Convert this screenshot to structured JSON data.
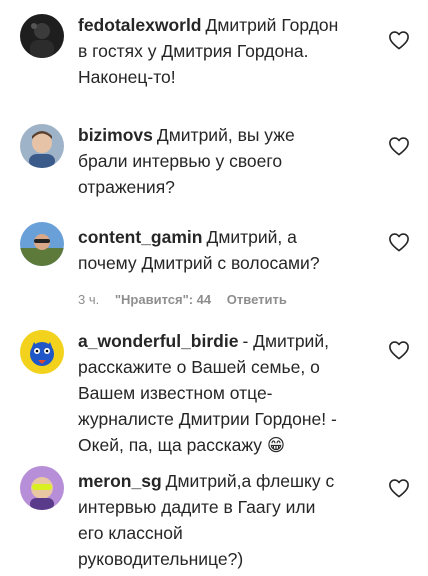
{
  "comments": [
    {
      "username": "fedotalexworld",
      "lines": [
        "Дмитрий Гордон",
        "в гостях у Дмитрия Гордона.",
        "Наконец-то!"
      ],
      "avatar_icon": "user-avatar-dark-photo"
    },
    {
      "username": "bizimovs",
      "lines": [
        "Дмитрий, вы уже",
        "брали интервью у своего",
        "отражения?"
      ],
      "avatar_icon": "user-avatar-boy-photo"
    },
    {
      "username": "content_gamin",
      "lines": [
        "Дмитрий, а",
        "почему Дмитрий с волосами?"
      ],
      "avatar_icon": "user-avatar-landscape-photo",
      "meta": {
        "time": "3 ч.",
        "likes": "\"Нравится\": 44",
        "reply": "Ответить"
      }
    },
    {
      "username": "a_wonderful_birdie",
      "lines": [
        "- Дмитрий,",
        "расскажите о Вашей семье, о",
        "Вашем известном отце-",
        "журналисте Дмитрии Гордоне! -",
        "Окей, па, ща расскажу 😁"
      ],
      "avatar_icon": "user-avatar-bird-cartoon"
    },
    {
      "username": "meron_sg",
      "lines": [
        "Дмитрий,а флешку с",
        "интервью дадите в Гаагу или",
        "его классной",
        "руководительнице?)"
      ],
      "avatar_icon": "user-avatar-sunglasses-photo"
    }
  ],
  "colors": {
    "text": "#262626",
    "secondary": "#8e8e8e",
    "heart_outline": "#262626"
  },
  "icons": {
    "like": "heart-outline-icon"
  }
}
